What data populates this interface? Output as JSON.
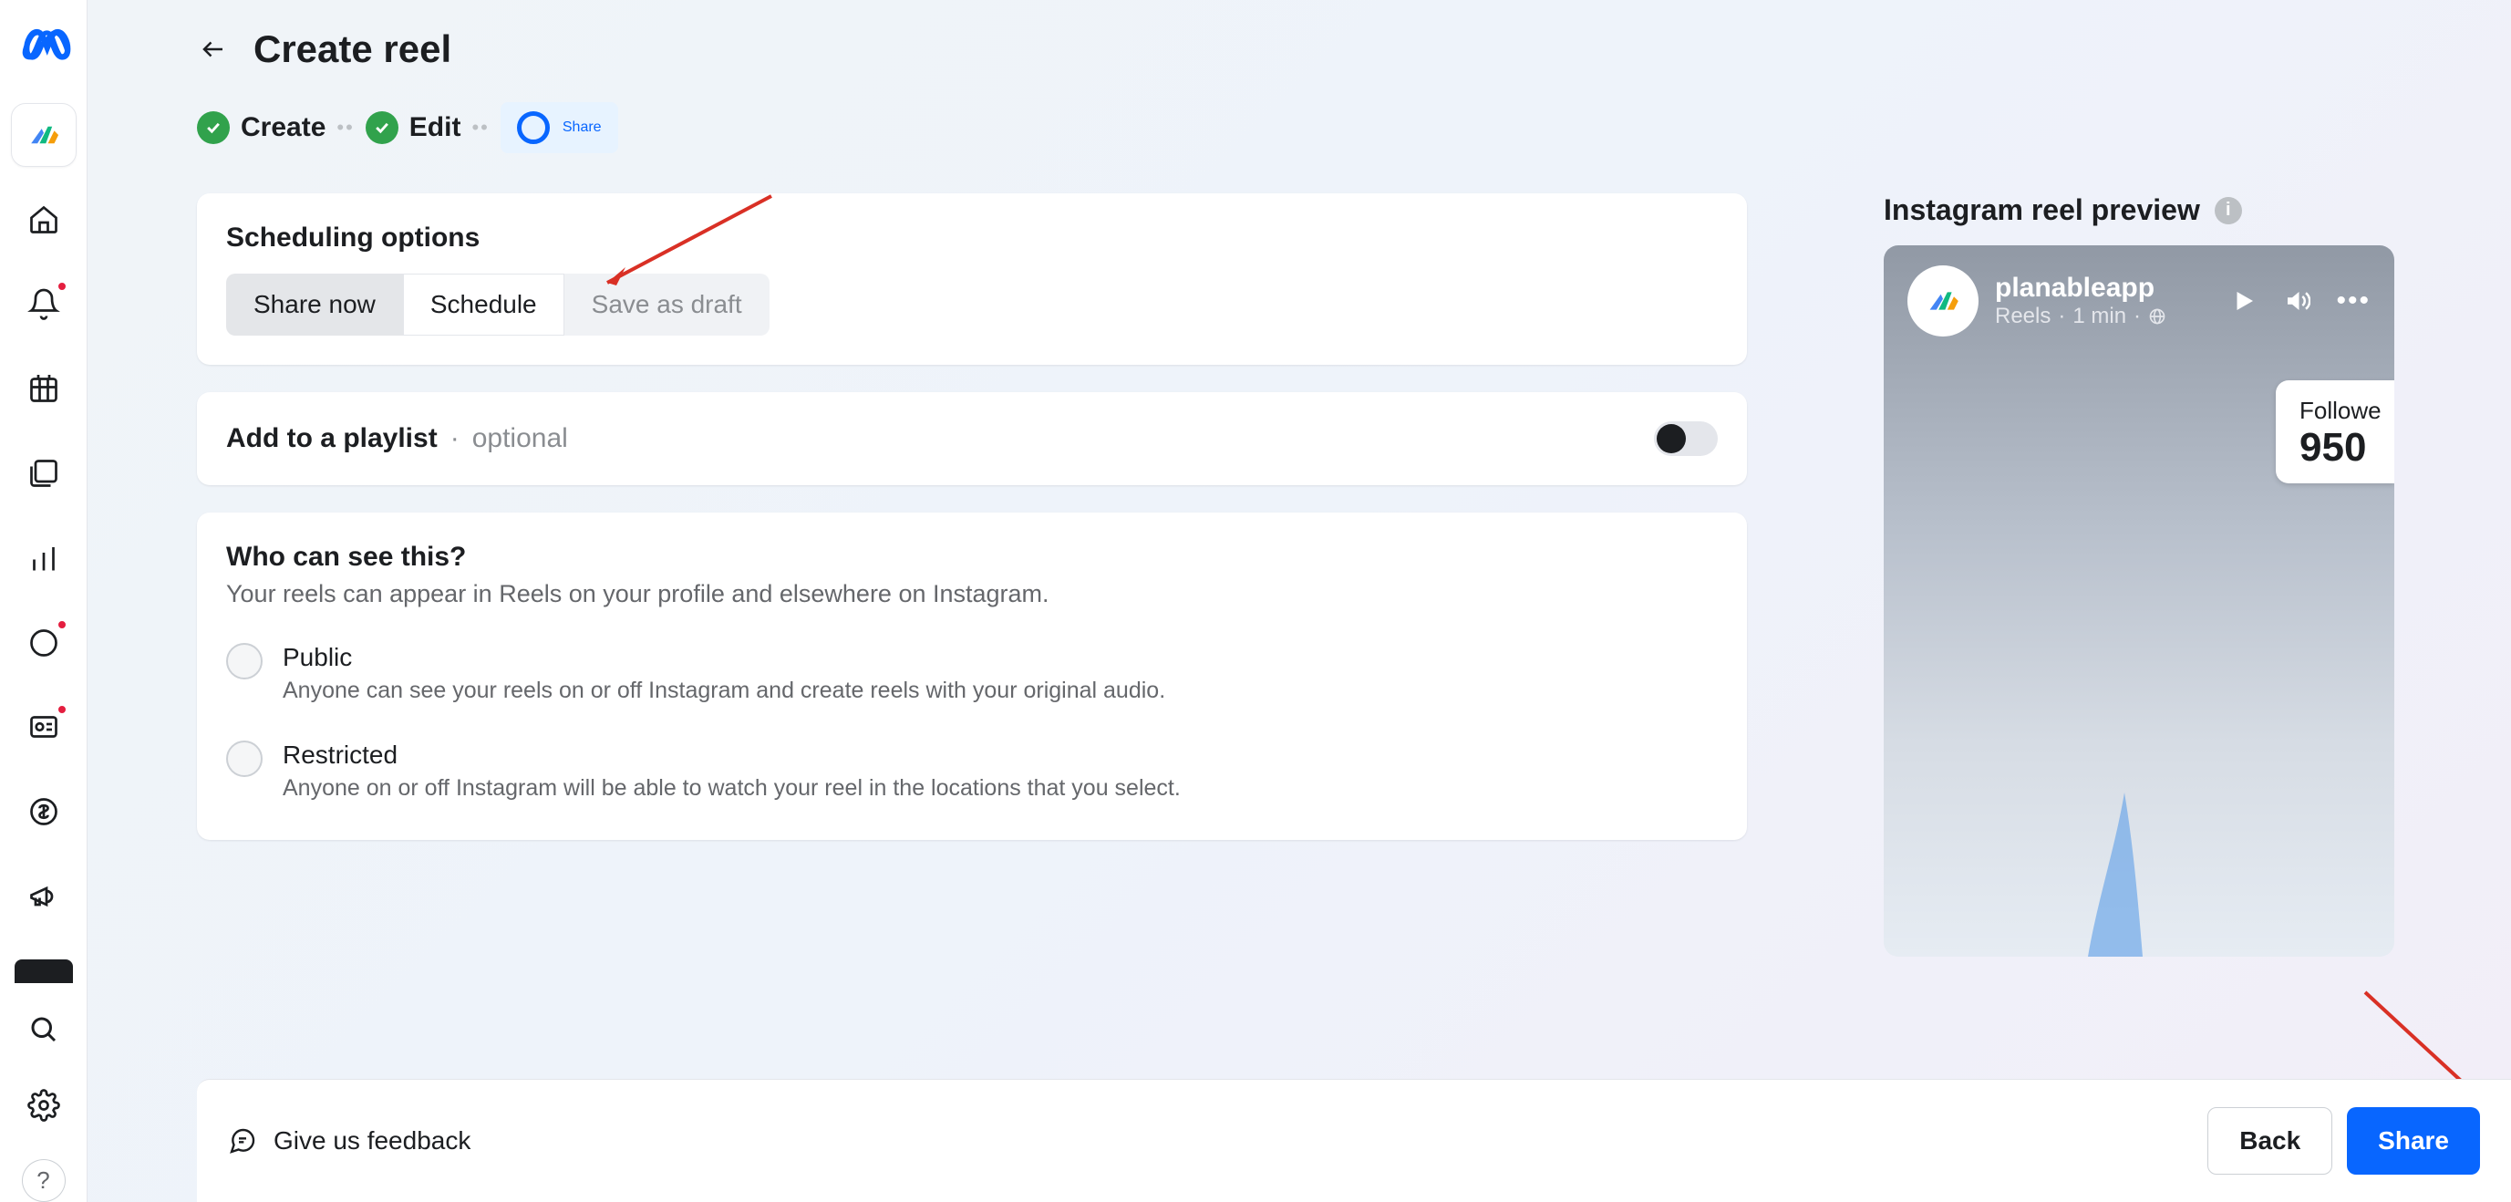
{
  "page": {
    "title": "Create reel"
  },
  "stepper": {
    "step1": "Create",
    "step2": "Edit",
    "step3": "Share"
  },
  "scheduling": {
    "title": "Scheduling options",
    "share_now": "Share now",
    "schedule": "Schedule",
    "save_draft": "Save as draft"
  },
  "playlist": {
    "label": "Add to a playlist",
    "separator": "·",
    "optional": "optional"
  },
  "visibility": {
    "title": "Who can see this?",
    "subtitle": "Your reels can appear in Reels on your profile and elsewhere on Instagram.",
    "public": {
      "label": "Public",
      "desc": "Anyone can see your reels on or off Instagram and create reels with your original audio."
    },
    "restricted": {
      "label": "Restricted",
      "desc": "Anyone on or off Instagram will be able to watch your reel in the locations that you select."
    }
  },
  "preview": {
    "title": "Instagram reel preview",
    "username": "planableapp",
    "meta_reels": "Reels",
    "meta_time": "1 min",
    "followers_label": "Followe",
    "followers_count": "950"
  },
  "footer": {
    "feedback": "Give us feedback",
    "back": "Back",
    "share": "Share"
  },
  "help": "?"
}
